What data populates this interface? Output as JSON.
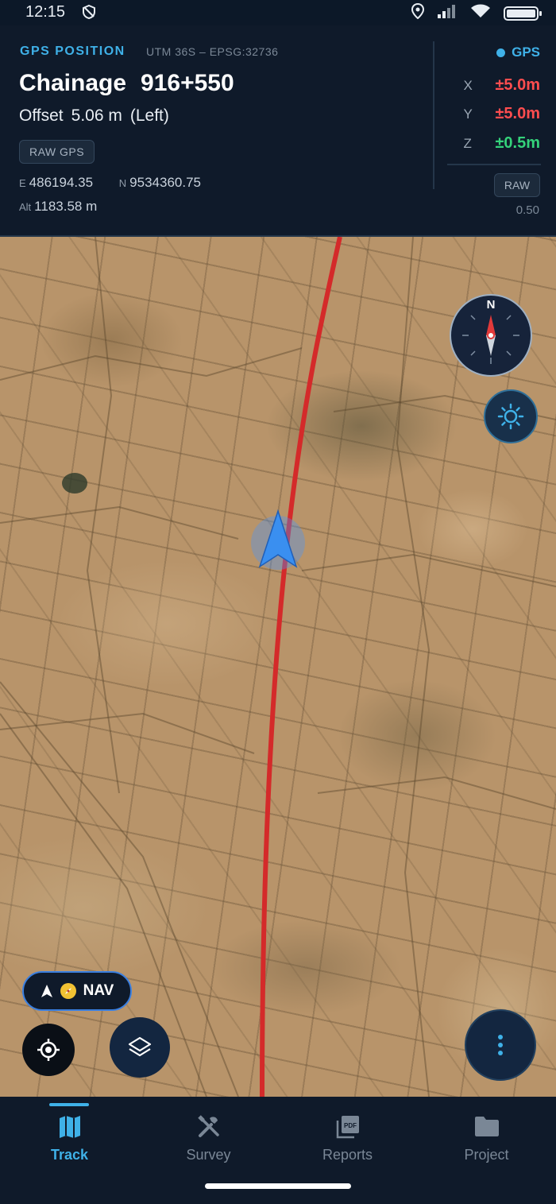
{
  "status_bar": {
    "time": "12:15"
  },
  "header": {
    "title": "GPS POSITION",
    "projection": "UTM 36S – EPSG:32736",
    "chainage_label": "Chainage",
    "chainage_value": "916+550",
    "offset_label": "Offset",
    "offset_value": "5.06 m",
    "offset_side": "(Left)",
    "raw_gps_button": "RAW GPS",
    "easting_label": "E",
    "easting": "486194.35",
    "northing_label": "N",
    "northing": "9534360.75",
    "alt_label": "Alt",
    "altitude": "1183.58 m"
  },
  "gps_panel": {
    "source": "GPS",
    "accuracy": [
      {
        "axis": "X",
        "value": "±5.0m",
        "status": "poor"
      },
      {
        "axis": "Y",
        "value": "±5.0m",
        "status": "poor"
      },
      {
        "axis": "Z",
        "value": "±0.5m",
        "status": "good"
      }
    ],
    "raw_button": "RAW",
    "raw_value": "0.50"
  },
  "map": {
    "compass_north": "N",
    "nav_button": "NAV",
    "alignment_color": "#d42a2a",
    "position_marker_color": "#3a8ff0"
  },
  "tabs": [
    {
      "label": "Track",
      "icon": "map-icon",
      "active": true
    },
    {
      "label": "Survey",
      "icon": "tools-icon",
      "active": false
    },
    {
      "label": "Reports",
      "icon": "pdf-icon",
      "active": false
    },
    {
      "label": "Project",
      "icon": "folder-icon",
      "active": false
    }
  ],
  "colors": {
    "accent": "#3fb1e8",
    "error": "#ff4d4f",
    "ok": "#34d27a",
    "background": "#0f1a2a"
  }
}
